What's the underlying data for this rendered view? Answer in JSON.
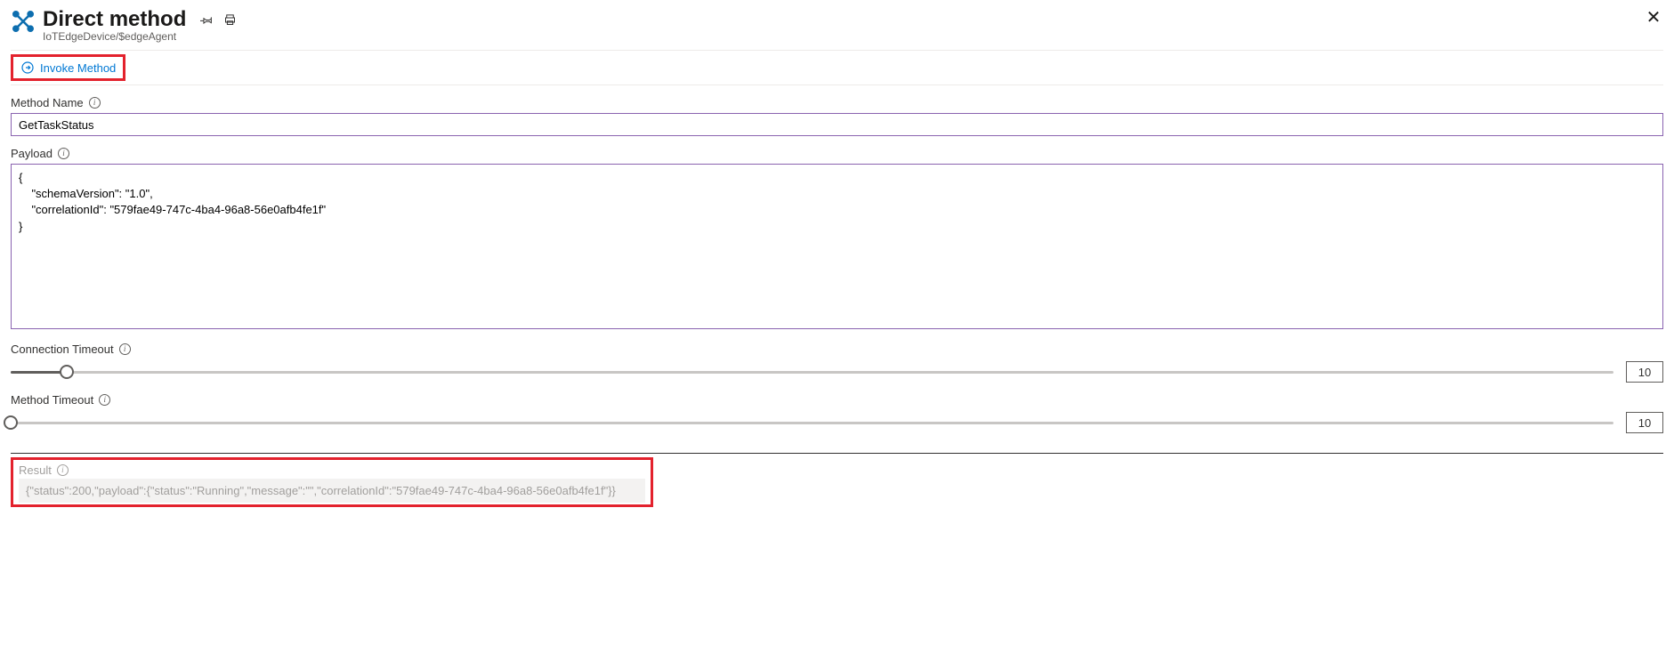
{
  "header": {
    "title": "Direct method",
    "breadcrumb": "IoTEdgeDevice/$edgeAgent"
  },
  "toolbar": {
    "invoke_label": "Invoke Method"
  },
  "method_name": {
    "label": "Method Name",
    "value": "GetTaskStatus"
  },
  "payload": {
    "label": "Payload",
    "value": "{\n    \"schemaVersion\": \"1.0\",\n    \"correlationId\": \"579fae49-747c-4ba4-96a8-56e0afb4fe1f\"\n}"
  },
  "connection_timeout": {
    "label": "Connection Timeout",
    "value": "10",
    "fill_pct": 3.5
  },
  "method_timeout": {
    "label": "Method Timeout",
    "value": "10",
    "fill_pct": 0
  },
  "result": {
    "label": "Result",
    "value": "{\"status\":200,\"payload\":{\"status\":\"Running\",\"message\":\"\",\"correlationId\":\"579fae49-747c-4ba4-96a8-56e0afb4fe1f\"}}"
  }
}
